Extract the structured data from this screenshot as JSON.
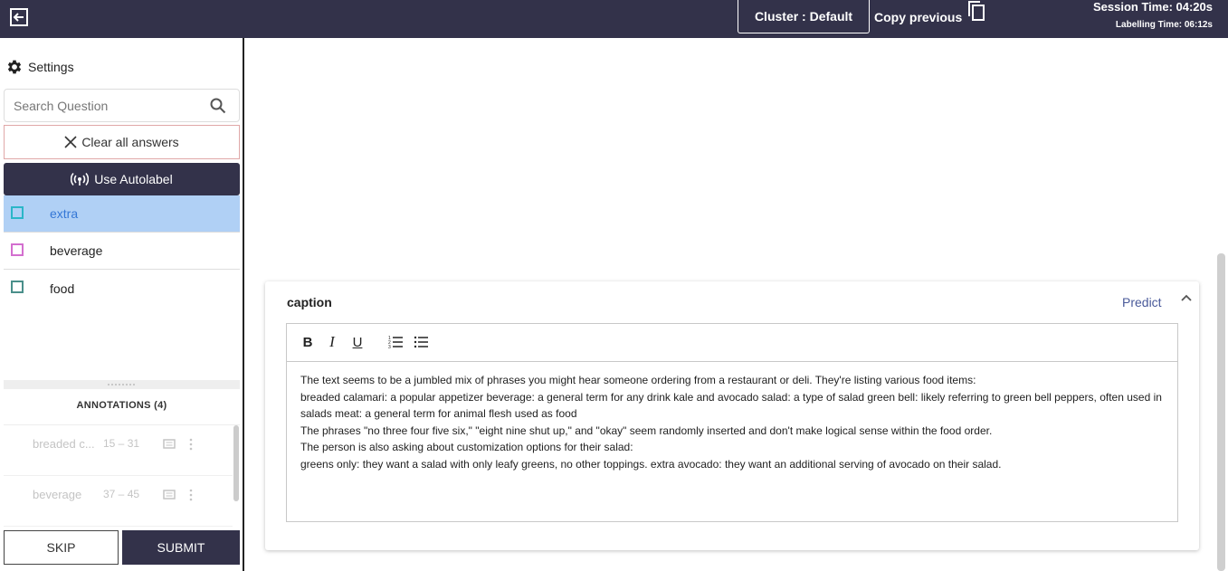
{
  "header": {
    "cluster_label": "Cluster : Default",
    "copy_previous": "Copy previous",
    "session_time": "Session Time: 04:20s",
    "labelling_time": "Labelling Time: 06:12s"
  },
  "sidebar": {
    "settings_label": "Settings",
    "search_placeholder": "Search Question",
    "clear_label": "Clear all answers",
    "autolabel_label": "Use Autolabel",
    "labels": [
      {
        "name": "extra",
        "color": "#2bb6c8",
        "active": true
      },
      {
        "name": "beverage",
        "color": "#d36fcf",
        "active": false
      },
      {
        "name": "food",
        "color": "#4a8f8a",
        "active": false
      }
    ],
    "annotations_title": "ANNOTATIONS (4)",
    "annotations": [
      {
        "name": "breaded c...",
        "range": "15 – 31"
      },
      {
        "name": "beverage",
        "range": "37 – 45"
      }
    ],
    "skip_label": "SKIP",
    "submit_label": "SUBMIT"
  },
  "caption": {
    "title": "caption",
    "predict_label": "Predict",
    "lines": [
      "The text seems to be a jumbled mix of phrases you might hear someone ordering from a restaurant or deli. They're listing various food items:",
      "breaded calamari: a popular appetizer beverage: a general term for any drink kale and avocado salad: a type of salad green bell: likely referring to green bell peppers, often used in salads meat: a general term for animal flesh used as food",
      "The phrases \"no three four five six,\" \"eight nine shut up,\" and \"okay\" seem randomly inserted and don't make logical sense within the food order.",
      "The person is also asking about customization options for their salad:",
      "greens only: they want a salad with only leafy greens, no other toppings. extra avocado: they want an additional serving of avocado on their salad."
    ]
  }
}
